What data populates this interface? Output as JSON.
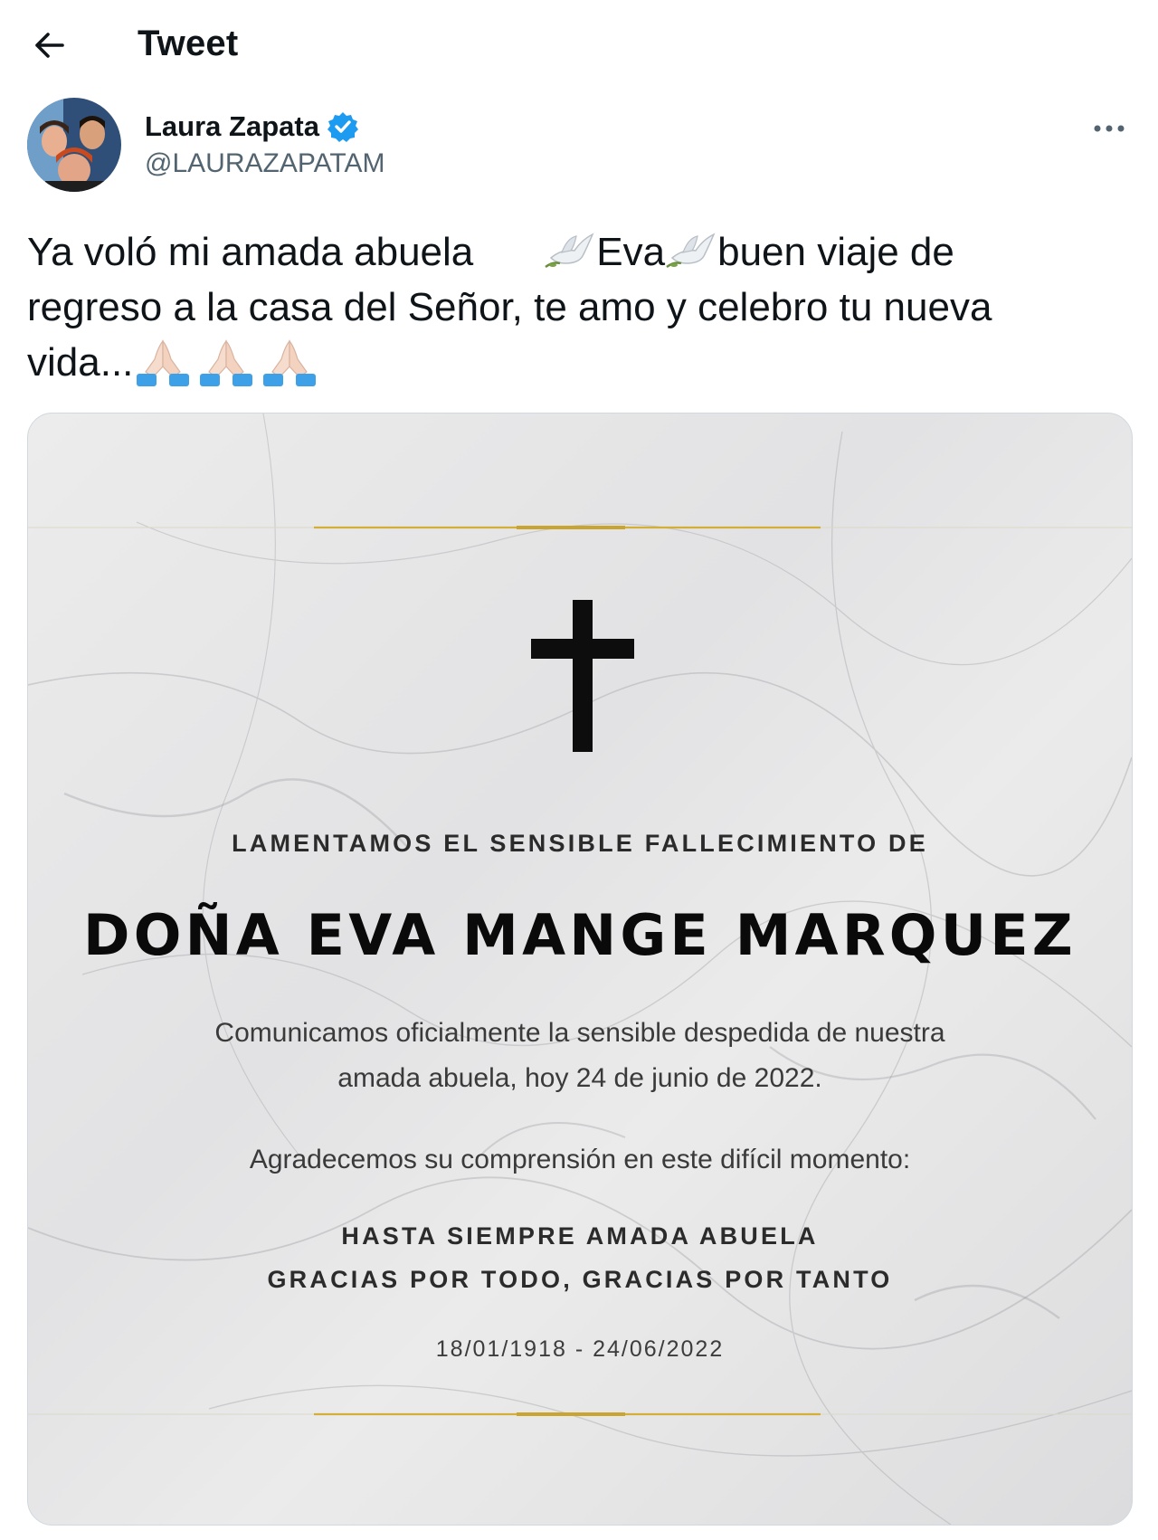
{
  "header": {
    "title": "Tweet",
    "back_icon": "arrow-left-icon"
  },
  "author": {
    "name": "Laura Zapata",
    "handle": "@LAURAZAPATAM",
    "verified": true,
    "more_icon": "ellipsis-icon"
  },
  "tweet": {
    "line1_part1": "Ya voló mi amada abuela",
    "line1_part2": "Eva",
    "line1_part3": "buen viaje de",
    "line2": "regreso a la casa del Señor, te amo y celebro tu nueva",
    "line3": "vida..."
  },
  "card": {
    "lead": "LAMENTAMOS EL SENSIBLE FALLECIMIENTO DE",
    "name": "DOÑA EVA MANGE MARQUEZ",
    "body_line1": "Comunicamos oficialmente la sensible despedida de nuestra",
    "body_line2": "amada abuela, hoy 24 de junio de 2022.",
    "body_line3": "Agradecemos su comprensión en este difícil momento:",
    "sign_line1": "HASTA SIEMPRE AMADA ABUELA",
    "sign_line2": "GRACIAS POR TODO, GRACIAS POR TANTO",
    "dates": "18/01/1918 - 24/06/2022"
  },
  "colors": {
    "verified": "#1d9bf0",
    "handle": "#536471",
    "gold": "#d4af37"
  }
}
